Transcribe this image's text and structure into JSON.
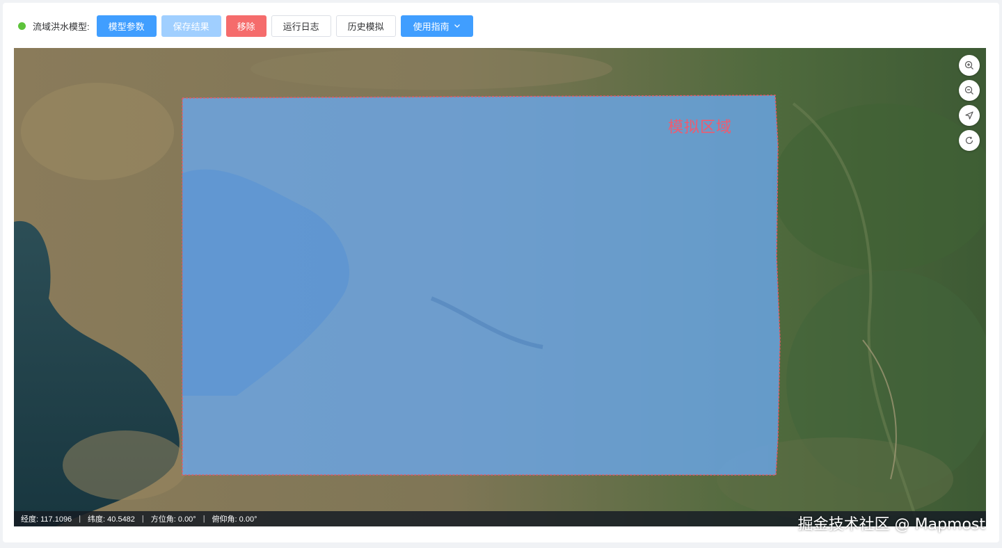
{
  "toolbar": {
    "model_label": "流域洪水模型:",
    "buttons": {
      "model_params": "模型参数",
      "save_result": "保存结果",
      "remove": "移除",
      "run_log": "运行日志",
      "history_sim": "历史模拟",
      "user_guide": "使用指南"
    }
  },
  "map": {
    "region_label": "模拟区域",
    "status": {
      "longitude": "经度: 117.1096",
      "latitude": "纬度: 40.5482",
      "azimuth": "方位角: 0.00°",
      "pitch": "俯仰角: 0.00°",
      "separator": "|"
    },
    "controls": [
      "zoom-in-icon",
      "zoom-out-icon",
      "locate-icon",
      "refresh-icon"
    ]
  },
  "watermark": "掘金技术社区 @ Mapmost",
  "colors": {
    "primary": "#409eff",
    "primary_disabled": "#a0cfff",
    "danger": "#f56c6c",
    "status_ok": "#5dc33b",
    "region_fill": "#6aa6e8",
    "region_border": "#e05a6a"
  }
}
